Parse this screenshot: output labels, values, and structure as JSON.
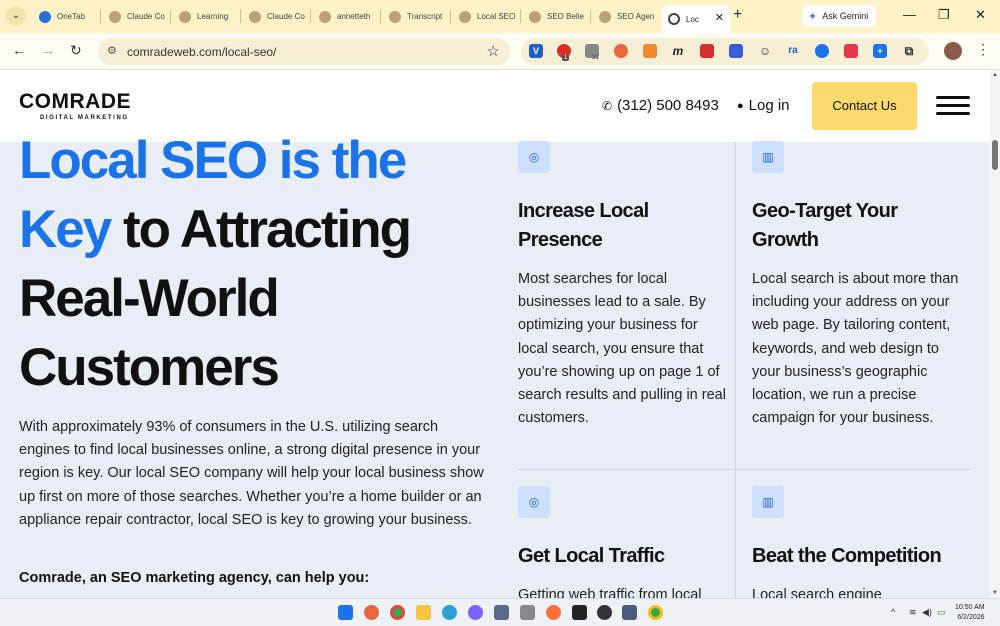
{
  "browser": {
    "tabs": [
      {
        "label": "OneTab",
        "color": "#2b6fd6"
      },
      {
        "label": "Claude Co",
        "color": "#b8a27a"
      },
      {
        "label": "Learning",
        "color": "#b8a27a"
      },
      {
        "label": "Claude Co",
        "color": "#b8a27a"
      },
      {
        "label": "annetteth",
        "color": "#b8a27a"
      },
      {
        "label": "Transcript",
        "color": "#b8a27a"
      },
      {
        "label": "Local SEO",
        "color": "#b8a27a"
      },
      {
        "label": "SEO Belie",
        "color": "#b8a27a"
      },
      {
        "label": "SEO Agen",
        "color": "#b8a27a"
      },
      {
        "label": "Loc",
        "color": "#444444"
      }
    ],
    "ask_gemini": "Ask Gemini",
    "url": "comradeweb.com/local-seo/",
    "extension_badges": {
      "first": "1",
      "second": "21"
    }
  },
  "site": {
    "logo_main": "COMRADE",
    "logo_sub": "DIGITAL MARKETING",
    "phone": "(312) 500 8493",
    "login": "Log in",
    "contact": "Contact Us"
  },
  "hero": {
    "line1": "Local SEO is the",
    "line2_blue": "Key",
    "line2_rest": " to Attracting",
    "line3": "Real-World",
    "line4": "Customers"
  },
  "intro": "With approximately 93% of consumers in the U.S. utilizing search engines to find local businesses online, a strong digital presence in your region is key. Our local SEO company will help your local business show up first on more of those searches. Whether you’re a home builder or an appliance repair contractor, local SEO is key to growing your business.",
  "subhead": "Comrade, an SEO marketing agency, can help you:",
  "features": [
    {
      "title": "Increase Local Presence",
      "body": "Most searches for local businesses lead to a sale. By optimizing your business for local search, you ensure that you’re showing up on page 1 of search results and pulling in real customers.",
      "icon": "target-icon"
    },
    {
      "title": "Geo-Target Your Growth",
      "body": "Local search is about more than including your address on your web page. By tailoring content, keywords, and web design to your business’s geographic location, we run a precise campaign for your business.",
      "icon": "map-icon"
    },
    {
      "title": "Get Local Traffic",
      "body": "Getting web traffic from local",
      "icon": "target-icon"
    },
    {
      "title": "Beat the Competition",
      "body": "Local search engine",
      "icon": "map-icon"
    }
  ],
  "taskbar": {
    "time": "10:50 AM",
    "date": "6/2/2026"
  }
}
